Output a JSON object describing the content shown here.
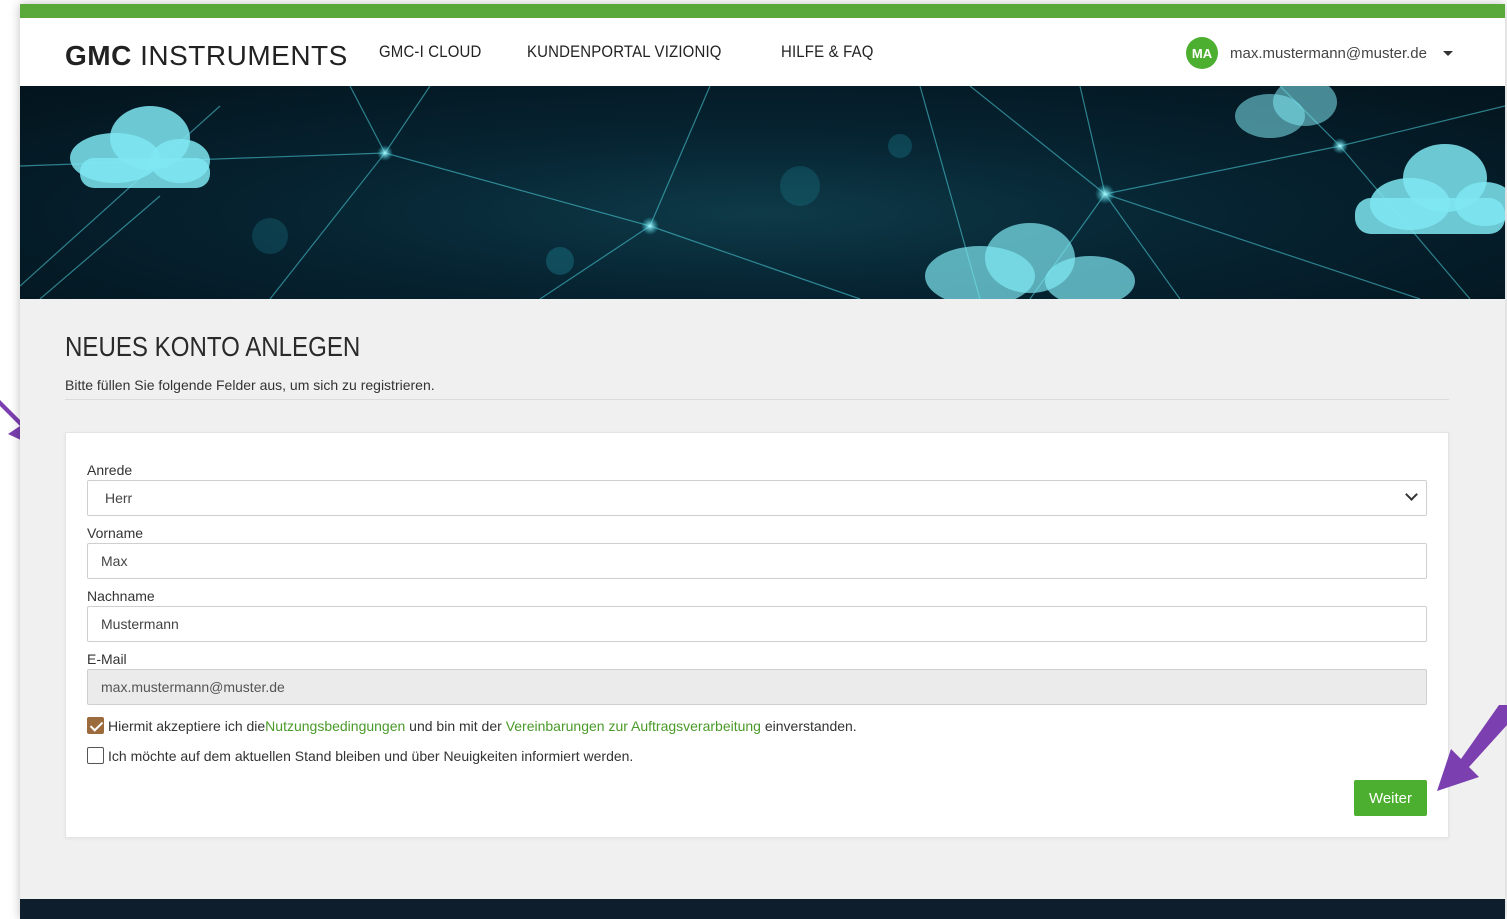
{
  "header": {
    "logo_bold": "GMC",
    "logo_light": "INSTRUMENTS",
    "nav": [
      {
        "label": "GMC-I CLOUD"
      },
      {
        "label": "KUNDENPORTAL VIZIONIQ"
      },
      {
        "label": "HILFE & FAQ"
      }
    ],
    "user": {
      "initials": "MA",
      "email": "max.mustermann@muster.de"
    }
  },
  "colors": {
    "accent": "#58a93a",
    "button": "#4caf30",
    "link": "#4a9a2a",
    "annotation_arrow": "#7b3fb0"
  },
  "page": {
    "title": "NEUES KONTO ANLEGEN",
    "subtitle": "Bitte füllen Sie folgende Felder aus, um sich zu registrieren."
  },
  "form": {
    "anrede": {
      "label": "Anrede",
      "value": "Herr"
    },
    "vorname": {
      "label": "Vorname",
      "value": "Max"
    },
    "nachname": {
      "label": "Nachname",
      "value": "Mustermann"
    },
    "email": {
      "label": "E-Mail",
      "value": "max.mustermann@muster.de"
    },
    "terms": {
      "checked": true,
      "text_1": "Hiermit akzeptiere ich die ",
      "link_1": "Nutzungsbedingungen",
      "text_2": " und bin mit der ",
      "link_2": "Vereinbarungen zur Auftragsverarbeitung",
      "text_3": " einverstanden."
    },
    "newsletter": {
      "checked": false,
      "text": "Ich möchte auf dem aktuellen Stand bleiben und über Neuigkeiten informiert werden."
    },
    "submit_label": "Weiter"
  }
}
